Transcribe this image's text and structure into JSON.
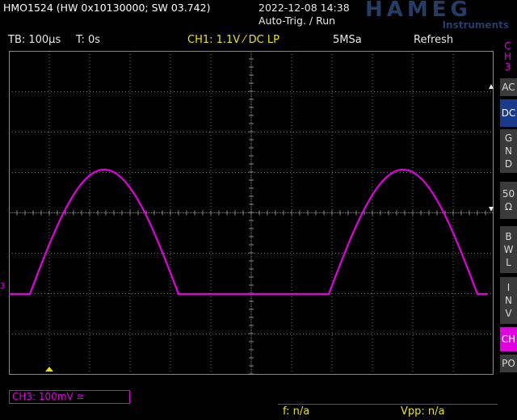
{
  "header": {
    "device_info": "HMO1524 (HW 0x10130000; SW 03.742)",
    "datetime": "2022-12-08 14:38",
    "trigger_state": "Auto-Trig. / Run",
    "logo_text": "HAMEG",
    "logo_sub": "Instruments"
  },
  "status": {
    "timebase": "TB: 100µs",
    "time_offset": "T: 0s",
    "ch1": "CH1: 1.1V ⁄ DC LP",
    "sample_rate": "5MSa",
    "acq_mode": "Refresh"
  },
  "menu": {
    "title_lines": [
      "C",
      "H",
      "3"
    ],
    "ac": "AC",
    "dc": "DC",
    "gnd": [
      "G",
      "N",
      "D"
    ],
    "ohm50": [
      "50",
      "Ω"
    ],
    "bwl": [
      "B",
      "W",
      "L"
    ],
    "inv": [
      "I",
      "N",
      "V"
    ],
    "ch": "CH",
    "po": "PO"
  },
  "waveform": {
    "channel_marker": "3",
    "color": "#e000e0",
    "grid_color": "#6e6e6e",
    "trigger_marker_color": "#e8e800"
  },
  "bottom": {
    "ch3_scale": "CH3: 100mV ≅",
    "freq": "f: n/a",
    "vpp": "Vpp: n/a"
  }
}
